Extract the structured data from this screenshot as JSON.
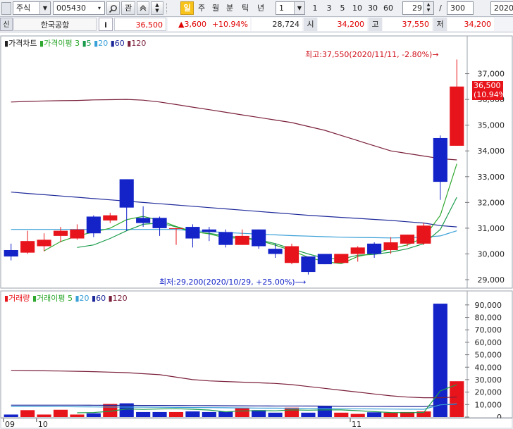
{
  "toolbar": {
    "market_type": "주식",
    "stock_code": "005430",
    "btn_interest": "관",
    "btn_day": "일",
    "btn_week": "주",
    "btn_month": "월",
    "btn_minute": "분",
    "btn_tick": "틱",
    "btn_year": "년",
    "period_value": "1",
    "quick_periods": [
      "1",
      "3",
      "5",
      "10",
      "30",
      "60"
    ],
    "display_count": "29",
    "separator": "/",
    "total_count": "300",
    "date_value": "2020/"
  },
  "quote": {
    "credit_badge": "신",
    "stock_name": "한국공항",
    "info_button": "i",
    "price": "36,500",
    "change": "▲3,600",
    "change_pct": "+10.94%",
    "volume": "28,724",
    "open_label": "시",
    "open_value": "34,200",
    "high_label": "고",
    "high_value": "37,550",
    "low_label": "저",
    "low_value": "34,200"
  },
  "price_chart": {
    "legend_title": "가격차트",
    "legend_ma_label": "가격이평",
    "legend_ma_periods": [
      "3",
      "5",
      "20",
      "60",
      "120"
    ],
    "annotation_high": "최고:37,550(2020/11/11, -2.80%)→",
    "annotation_low": "최저:29,200(2020/10/29, +25.00%)⟶",
    "current_price_tag": "36,500",
    "current_pct_tag": "(10.94%)",
    "y_ticks": [
      "37,000",
      "36,000",
      "35,000",
      "34,000",
      "33,000",
      "32,000",
      "31,000",
      "30,000",
      "29,000"
    ]
  },
  "volume_chart": {
    "legend_title": "거래량",
    "legend_ma_label": "거래이평",
    "legend_ma_periods": [
      "5",
      "20",
      "60",
      "120"
    ],
    "y_ticks": [
      "90,000",
      "80,000",
      "70,000",
      "60,000",
      "50,000",
      "40,000",
      "30,000",
      "20,000",
      "10,000",
      "0"
    ]
  },
  "x_axis": {
    "labels": [
      "09",
      "10",
      "11"
    ]
  },
  "colors": {
    "up": "#e8141b",
    "down": "#1323c8",
    "ma3": "#2fa82f",
    "ma5": "#1c9c4c",
    "ma20": "#3aa0d8",
    "ma60": "#1f2a9a",
    "ma120": "#7a1f3a"
  },
  "chart_data": {
    "type": "candlestick",
    "price": {
      "candles": [
        {
          "o": 30150,
          "h": 30400,
          "l": 29750,
          "c": 29900
        },
        {
          "o": 30050,
          "h": 30900,
          "l": 30000,
          "c": 30500
        },
        {
          "o": 30300,
          "h": 30800,
          "l": 30100,
          "c": 30550
        },
        {
          "o": 30700,
          "h": 31050,
          "l": 30450,
          "c": 30900
        },
        {
          "o": 30600,
          "h": 31150,
          "l": 30550,
          "c": 30950
        },
        {
          "o": 31450,
          "h": 31500,
          "l": 30650,
          "c": 30800
        },
        {
          "o": 31300,
          "h": 31600,
          "l": 31200,
          "c": 31500
        },
        {
          "o": 32900,
          "h": 32900,
          "l": 30900,
          "c": 31800
        },
        {
          "o": 31400,
          "h": 31850,
          "l": 31050,
          "c": 31200
        },
        {
          "o": 31400,
          "h": 31450,
          "l": 30700,
          "c": 31000
        },
        {
          "o": 31000,
          "h": 31000,
          "l": 30350,
          "c": 31000
        },
        {
          "o": 31050,
          "h": 31150,
          "l": 30250,
          "c": 30600
        },
        {
          "o": 30950,
          "h": 31050,
          "l": 30500,
          "c": 30850
        },
        {
          "o": 30850,
          "h": 30950,
          "l": 30250,
          "c": 30350
        },
        {
          "o": 30350,
          "h": 30950,
          "l": 30350,
          "c": 30700
        },
        {
          "o": 30950,
          "h": 30950,
          "l": 30200,
          "c": 30300
        },
        {
          "o": 30200,
          "h": 30400,
          "l": 29850,
          "c": 30000
        },
        {
          "o": 29650,
          "h": 30400,
          "l": 29600,
          "c": 30300
        },
        {
          "o": 29900,
          "h": 29900,
          "l": 29200,
          "c": 29300
        },
        {
          "o": 30000,
          "h": 30000,
          "l": 29600,
          "c": 29600
        },
        {
          "o": 29650,
          "h": 30000,
          "l": 29650,
          "c": 30000
        },
        {
          "o": 30000,
          "h": 30300,
          "l": 29700,
          "c": 30250
        },
        {
          "o": 30400,
          "h": 30450,
          "l": 29850,
          "c": 30000
        },
        {
          "o": 30150,
          "h": 30650,
          "l": 30000,
          "c": 30450
        },
        {
          "o": 30400,
          "h": 30750,
          "l": 30300,
          "c": 30750
        },
        {
          "o": 30400,
          "h": 31200,
          "l": 30350,
          "c": 31100
        },
        {
          "o": 34500,
          "h": 34600,
          "l": 32100,
          "c": 32800
        },
        {
          "o": 34200,
          "h": 37550,
          "l": 34200,
          "c": 36500
        }
      ],
      "ma3": [
        null,
        null,
        30120,
        30480,
        30700,
        30850,
        31000,
        31330,
        31460,
        31300,
        31070,
        30870,
        30780,
        30620,
        30620,
        30530,
        30340,
        30130,
        29870,
        29700,
        29620,
        29900,
        30030,
        30200,
        30350,
        30630,
        31500,
        33500
      ],
      "ma5": [
        null,
        null,
        null,
        null,
        30250,
        30350,
        30600,
        30900,
        31150,
        31200,
        31050,
        30850,
        30800,
        30700,
        30630,
        30550,
        30400,
        30200,
        30000,
        29830,
        29800,
        29950,
        29980,
        30070,
        30200,
        30400,
        30950,
        32200
      ],
      "ma20": [
        30950,
        30950,
        30950,
        30950,
        30950,
        30950,
        30950,
        30950,
        30950,
        30950,
        30950,
        30900,
        30870,
        30830,
        30800,
        30770,
        30740,
        30710,
        30690,
        30670,
        30650,
        30640,
        30630,
        30620,
        30630,
        30650,
        30700,
        30900
      ],
      "ma60": [
        32400,
        32350,
        32300,
        32250,
        32200,
        32150,
        32100,
        32050,
        32000,
        31950,
        31900,
        31850,
        31800,
        31750,
        31700,
        31650,
        31600,
        31550,
        31500,
        31460,
        31420,
        31380,
        31340,
        31300,
        31250,
        31200,
        31100,
        31050
      ],
      "ma120": [
        35900,
        35920,
        35940,
        35950,
        35960,
        35980,
        35990,
        36000,
        35970,
        35900,
        35800,
        35700,
        35600,
        35500,
        35400,
        35300,
        35200,
        35100,
        34950,
        34800,
        34600,
        34400,
        34200,
        34000,
        33900,
        33800,
        33700,
        33650
      ],
      "high_marker": {
        "price": 37550,
        "date": "2020/11/11",
        "pct": "-2.80%"
      },
      "low_marker": {
        "price": 29200,
        "date": "2020/10/29",
        "pct": "+25.00%"
      },
      "ylim": [
        28700,
        38000
      ]
    },
    "volume": {
      "values": [
        2000,
        5500,
        2000,
        5800,
        2000,
        3000,
        10500,
        11000,
        4000,
        4000,
        4000,
        4500,
        4000,
        4500,
        7500,
        5500,
        3500,
        7500,
        3500,
        8500,
        3500,
        2500,
        3800,
        3500,
        4000,
        4500,
        91000,
        28724
      ],
      "ma5": [
        null,
        null,
        null,
        null,
        3400,
        3600,
        4600,
        6500,
        6100,
        6500,
        6700,
        6200,
        5600,
        4200,
        4900,
        5200,
        5000,
        5700,
        5500,
        5700,
        5700,
        5100,
        4300,
        3600,
        3500,
        3700,
        21000,
        26000
      ],
      "ma20": [
        8500,
        8500,
        8400,
        8300,
        8200,
        8100,
        8000,
        8000,
        7900,
        7800,
        7700,
        7600,
        7500,
        7400,
        7300,
        7200,
        7100,
        7000,
        6900,
        6800,
        6700,
        6600,
        6500,
        6400,
        6300,
        6200,
        9800,
        10500
      ],
      "ma60": [
        9500,
        9500,
        9500,
        9500,
        9500,
        9450,
        9400,
        9350,
        9300,
        9250,
        9200,
        9150,
        9100,
        9050,
        9000,
        8950,
        8900,
        8850,
        8800,
        8750,
        8700,
        8650,
        8600,
        8550,
        8500,
        8450,
        9800,
        10200
      ],
      "ma120": [
        37500,
        37300,
        37100,
        36900,
        36700,
        36400,
        36000,
        35600,
        34800,
        34000,
        32000,
        30000,
        29000,
        28500,
        28000,
        27500,
        27000,
        26000,
        24500,
        23000,
        21500,
        20000,
        18500,
        17000,
        16000,
        15500,
        15500,
        16000
      ],
      "ylim": [
        0,
        95000
      ]
    },
    "x_labels": [
      {
        "index": 0,
        "label": "09"
      },
      {
        "index": 2,
        "label": "10"
      },
      {
        "index": 21,
        "label": "11"
      }
    ]
  }
}
